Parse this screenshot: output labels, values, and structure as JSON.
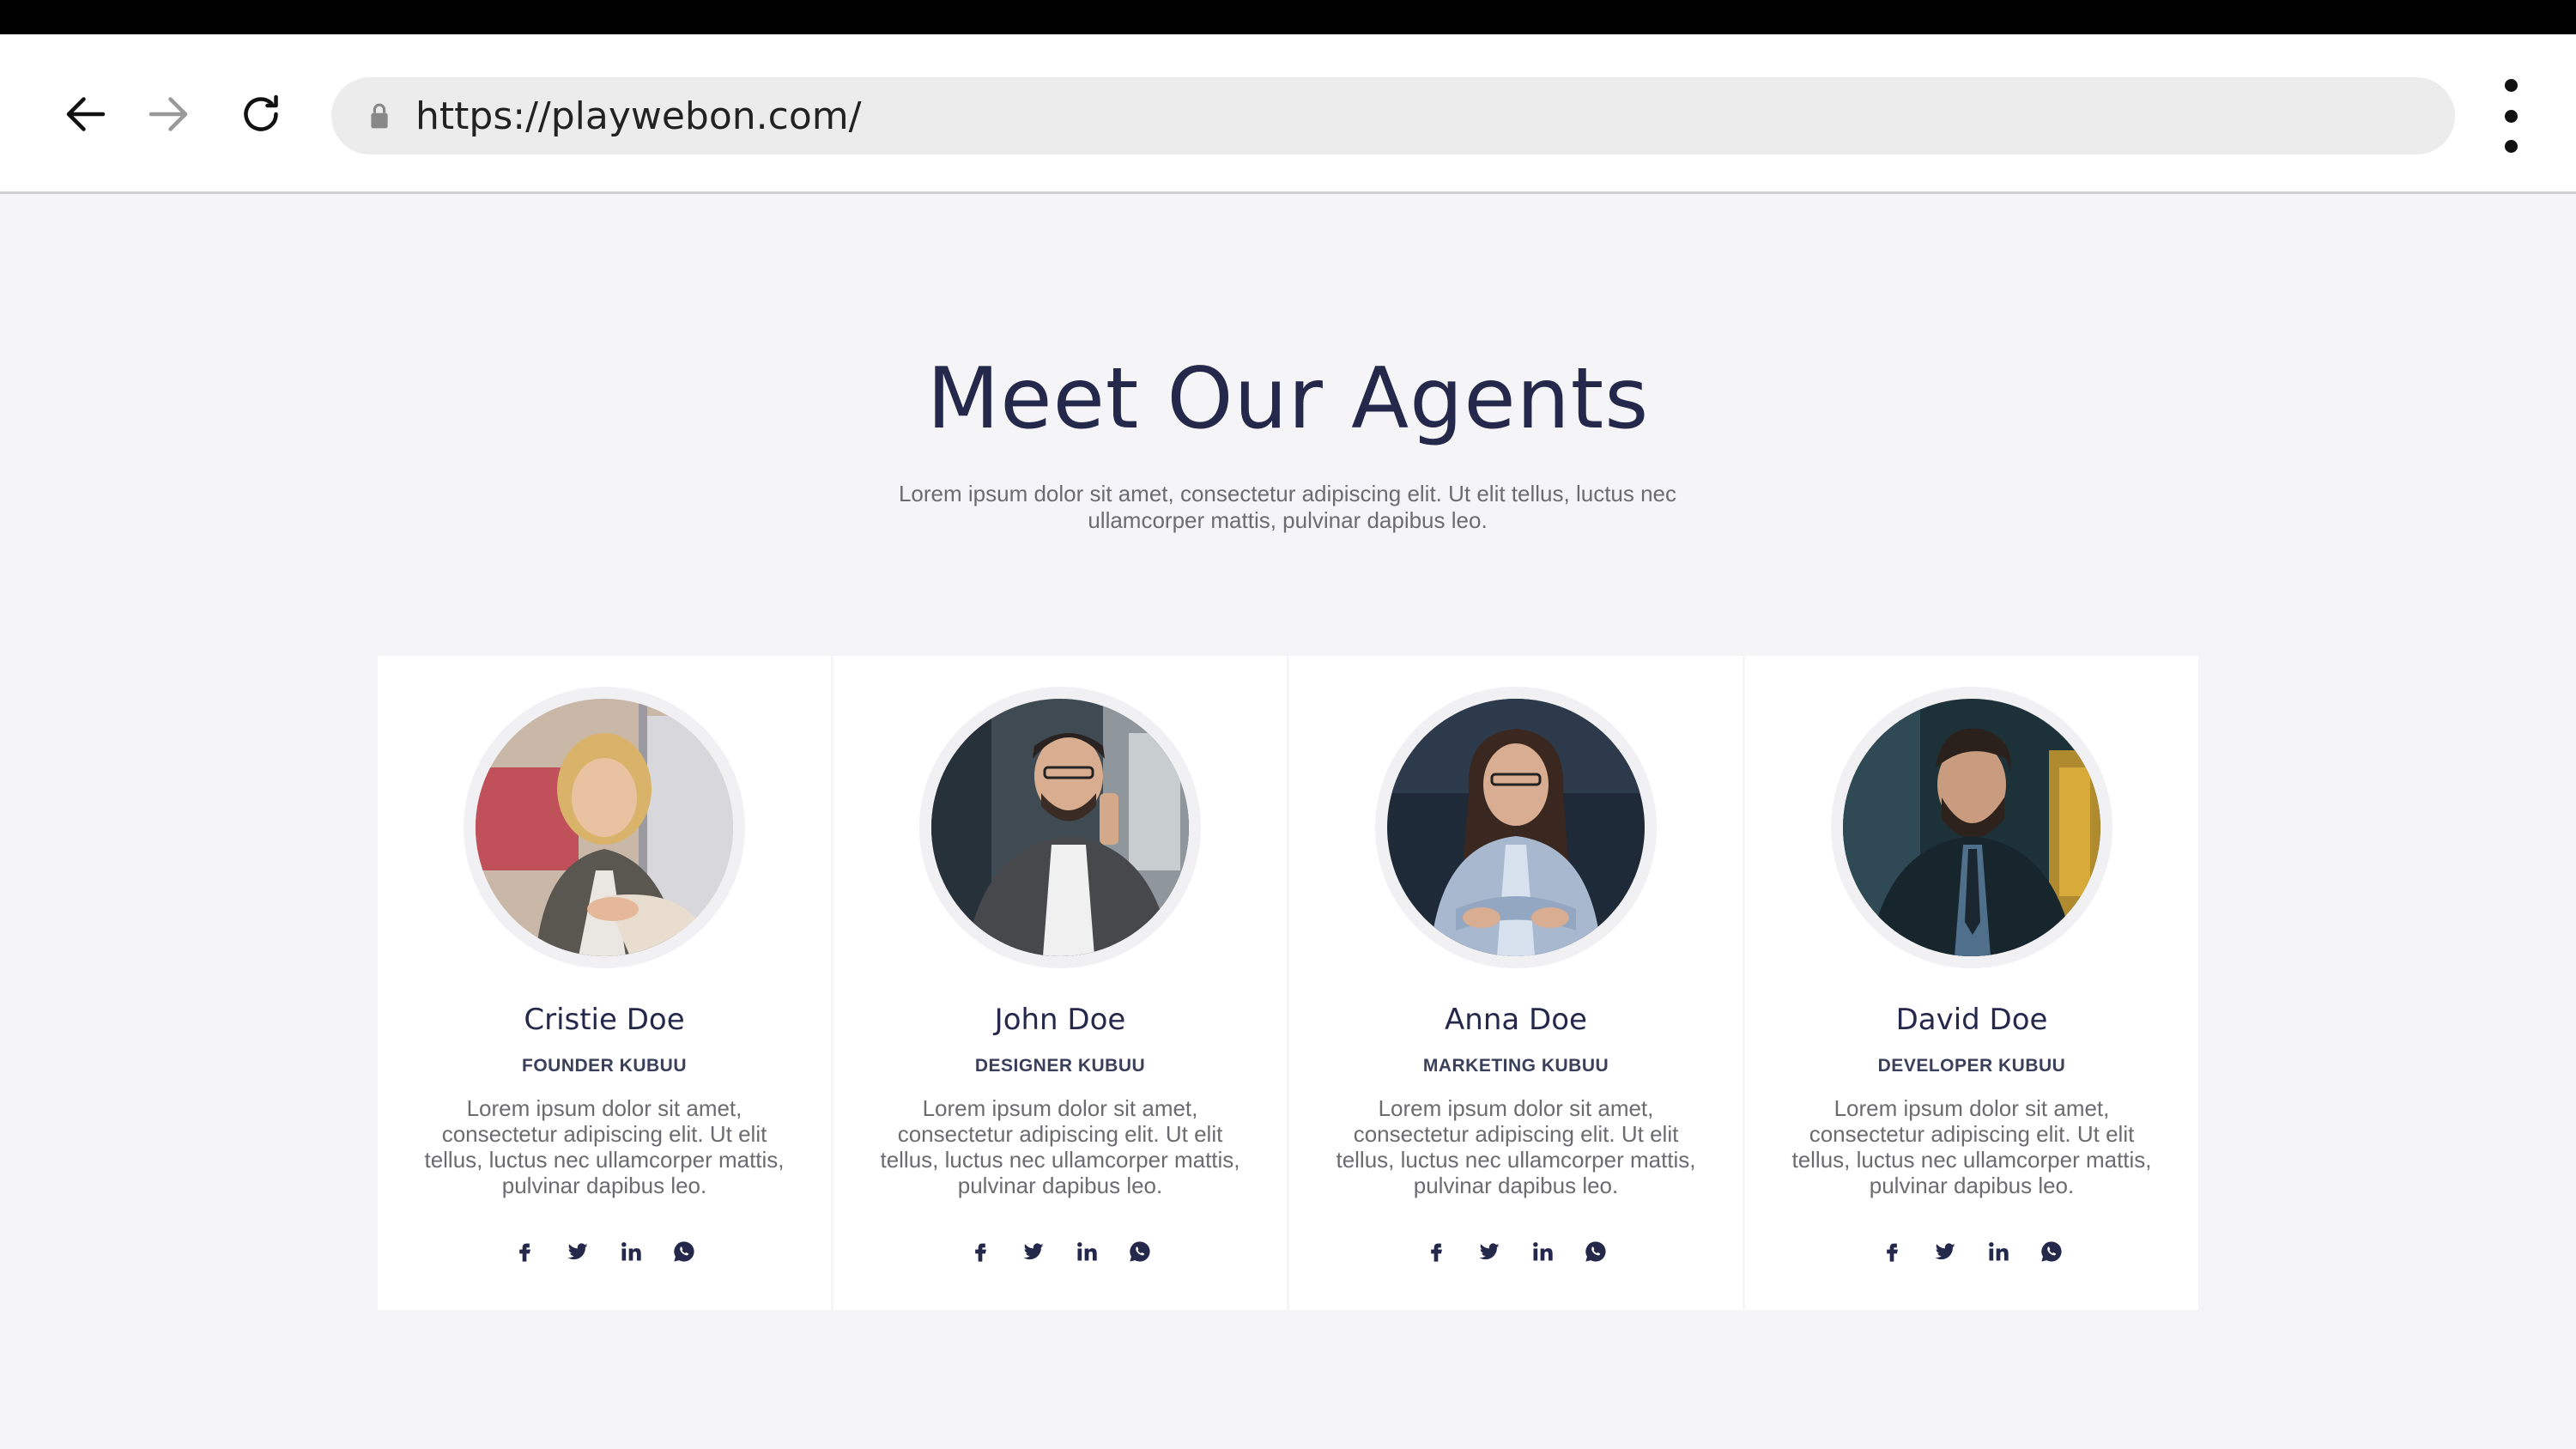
{
  "browser": {
    "url": "https://playwebon.com/",
    "back_icon": "arrow-left-icon",
    "forward_icon": "arrow-right-icon",
    "reload_icon": "reload-icon",
    "menu_icon": "kebab-menu-icon"
  },
  "section": {
    "title": "Meet Our Agents",
    "subtitle": "Lorem ipsum dolor sit amet, consectetur adipiscing elit. Ut elit tellus, luctus nec ullamcorper mattis, pulvinar dapibus leo."
  },
  "agents": [
    {
      "name": "Cristie Doe",
      "role": "FOUNDER KUBUU",
      "bio": "Lorem ipsum dolor sit amet, consectetur adipiscing elit. Ut elit tellus, luctus nec ullamcorper mattis, pulvinar dapibus leo."
    },
    {
      "name": "John Doe",
      "role": "DESIGNER KUBUU",
      "bio": "Lorem ipsum dolor sit amet, consectetur adipiscing elit. Ut elit tellus, luctus nec ullamcorper mattis, pulvinar dapibus leo."
    },
    {
      "name": "Anna Doe",
      "role": "MARKETING KUBUU",
      "bio": "Lorem ipsum dolor sit amet, consectetur adipiscing elit. Ut elit tellus, luctus nec ullamcorper mattis, pulvinar dapibus leo."
    },
    {
      "name": "David Doe",
      "role": "DEVELOPER KUBUU",
      "bio": "Lorem ipsum dolor sit amet, consectetur adipiscing elit. Ut elit tellus, luctus nec ullamcorper mattis, pulvinar dapibus leo."
    }
  ],
  "social_icons": [
    "facebook-icon",
    "twitter-icon",
    "linkedin-icon",
    "whatsapp-icon"
  ],
  "colors": {
    "heading": "#24284a",
    "body_text": "#6b6b70",
    "page_bg": "#f5f5f7",
    "card_bg": "#ffffff"
  }
}
